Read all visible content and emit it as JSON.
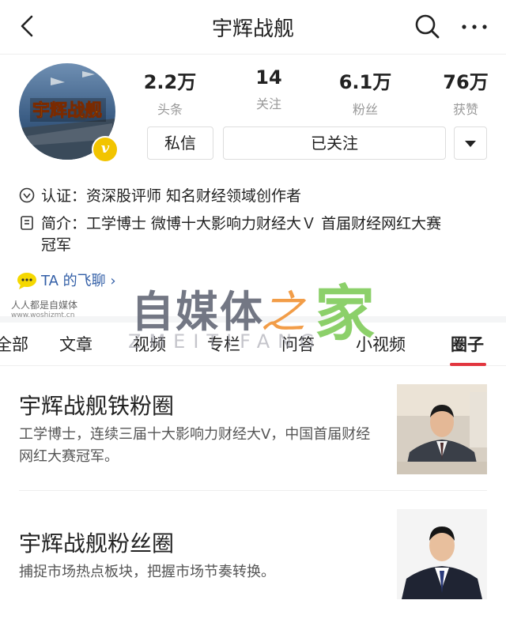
{
  "nav": {
    "title": "宇辉战舰"
  },
  "avatar": {
    "logo_text": "宇辉战舰",
    "verified_badge": "v"
  },
  "stats": [
    {
      "num": "2.2万",
      "label": "头条"
    },
    {
      "num": "14",
      "label": "关注"
    },
    {
      "num": "6.1万",
      "label": "粉丝"
    },
    {
      "num": "76万",
      "label": "获赞"
    }
  ],
  "actions": {
    "message": "私信",
    "following": "已关注"
  },
  "profile": {
    "cert_label": "认证：",
    "cert_value": "资深股评师 知名财经领域创作者",
    "intro_label": "简介：",
    "intro_value": "工学博士 微博十大影响力财经大Ｖ 首届财经网红大赛",
    "intro_value2": "冠军"
  },
  "chat": {
    "label": "TA 的飞聊",
    "arrow": "›"
  },
  "watermark": {
    "small1": "人人都是自媒体",
    "small2": "www.woshizmt.cn",
    "big": "自媒体",
    "zhi": "之",
    "jia": "家",
    "en": "ZMEITIFANG"
  },
  "tabs": [
    "全部",
    "文章",
    "视频",
    "专栏",
    "问答",
    "小视频",
    "圈子"
  ],
  "active_tab": "圈子",
  "cards": [
    {
      "title": "宇辉战舰铁粉圈",
      "desc": "工学博士，连续三届十大影响力财经大V，中国首届财经网红大赛冠军。"
    },
    {
      "title": "宇辉战舰粉丝圈",
      "desc": "捕捉市场热点板块，把握市场节奏转换。"
    }
  ],
  "colors": {
    "accent": "#e2363f",
    "link": "#335fa7",
    "badge": "#f2c400"
  }
}
